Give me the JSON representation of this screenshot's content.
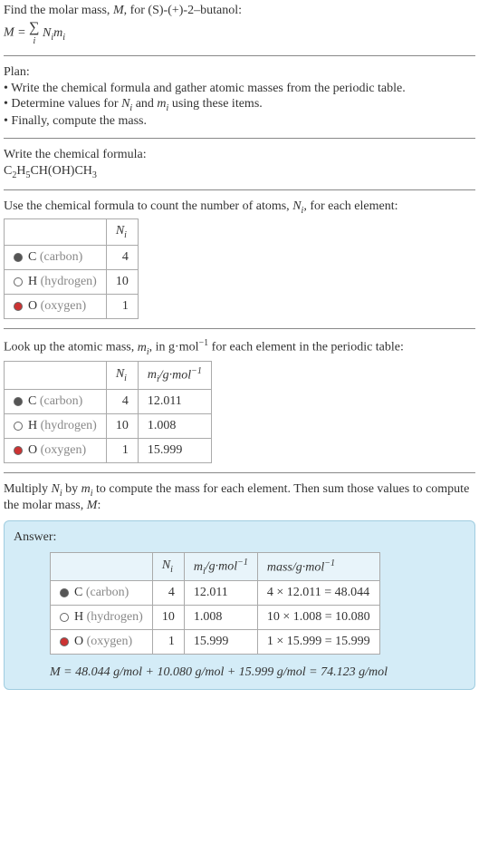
{
  "intro": {
    "line1": "Find the molar mass, M, for (S)-(+)-2–butanol:",
    "formula_lhs": "M = ",
    "formula_rhs": " N",
    "formula_sub_i": "i",
    "formula_m": "m",
    "sum_sub": "i"
  },
  "plan": {
    "title": "Plan:",
    "item1": "• Write the chemical formula and gather atomic masses from the periodic table.",
    "item2": "• Determine values for Nᵢ and mᵢ using these items.",
    "item3": "• Finally, compute the mass."
  },
  "chem": {
    "title": "Write the chemical formula:",
    "formula": "C₂H₅CH(OH)CH₃"
  },
  "count": {
    "title": "Use the chemical formula to count the number of atoms, Nᵢ, for each element:",
    "header_n": "Nᵢ",
    "rows": [
      {
        "symbol": "C",
        "name": "(carbon)",
        "n": "4"
      },
      {
        "symbol": "H",
        "name": "(hydrogen)",
        "n": "10"
      },
      {
        "symbol": "O",
        "name": "(oxygen)",
        "n": "1"
      }
    ]
  },
  "atomic": {
    "title": "Look up the atomic mass, mᵢ, in g·mol⁻¹ for each element in the periodic table:",
    "header_n": "Nᵢ",
    "header_m": "mᵢ/g·mol⁻¹",
    "rows": [
      {
        "symbol": "C",
        "name": "(carbon)",
        "n": "4",
        "m": "12.011"
      },
      {
        "symbol": "H",
        "name": "(hydrogen)",
        "n": "10",
        "m": "1.008"
      },
      {
        "symbol": "O",
        "name": "(oxygen)",
        "n": "1",
        "m": "15.999"
      }
    ]
  },
  "multiply": {
    "title": "Multiply Nᵢ by mᵢ to compute the mass for each element. Then sum those values to compute the molar mass, M:"
  },
  "answer": {
    "label": "Answer:",
    "header_n": "Nᵢ",
    "header_m": "mᵢ/g·mol⁻¹",
    "header_mass": "mass/g·mol⁻¹",
    "rows": [
      {
        "symbol": "C",
        "name": "(carbon)",
        "n": "4",
        "m": "12.011",
        "mass": "4 × 12.011 = 48.044"
      },
      {
        "symbol": "H",
        "name": "(hydrogen)",
        "n": "10",
        "m": "1.008",
        "mass": "10 × 1.008 = 10.080"
      },
      {
        "symbol": "O",
        "name": "(oxygen)",
        "n": "1",
        "m": "15.999",
        "mass": "1 × 15.999 = 15.999"
      }
    ],
    "final": "M = 48.044 g/mol + 10.080 g/mol + 15.999 g/mol = 74.123 g/mol"
  },
  "chart_data": {
    "type": "table",
    "title": "Molar mass calculation for (S)-(+)-2-butanol",
    "elements": [
      {
        "element": "C",
        "name": "carbon",
        "N_i": 4,
        "m_i_g_per_mol": 12.011,
        "mass_g_per_mol": 48.044
      },
      {
        "element": "H",
        "name": "hydrogen",
        "N_i": 10,
        "m_i_g_per_mol": 1.008,
        "mass_g_per_mol": 10.08
      },
      {
        "element": "O",
        "name": "oxygen",
        "N_i": 1,
        "m_i_g_per_mol": 15.999,
        "mass_g_per_mol": 15.999
      }
    ],
    "molar_mass_g_per_mol": 74.123
  }
}
